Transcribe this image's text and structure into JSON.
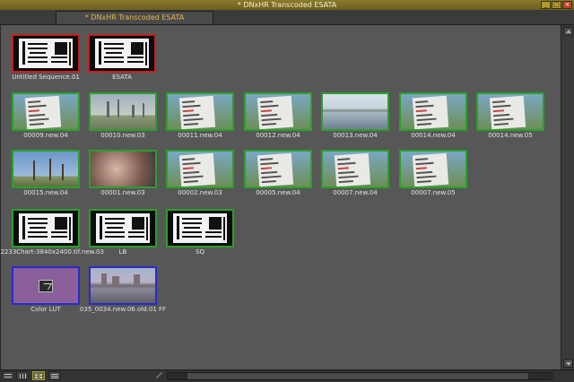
{
  "window": {
    "title": "* DNxHR Transcoded ESATA"
  },
  "tabs": [
    {
      "label": "* DNxHR Transcoded ESATA",
      "active": true
    }
  ],
  "colors": {
    "selected_border": "#c81e1e",
    "clip_border": "#2aa02a",
    "effect_border": "#2a2acc",
    "tab_text": "#e8b84a"
  },
  "clips": [
    {
      "label": "Untitled Sequence.01",
      "thumb": "chart",
      "border": "red"
    },
    {
      "label": "ESATA",
      "thumb": "chart",
      "border": "red"
    },
    {
      "label": "00009.new.04",
      "thumb": "board",
      "border": "green"
    },
    {
      "label": "00010.new.03",
      "thumb": "city",
      "border": "green"
    },
    {
      "label": "00011.new.04",
      "thumb": "board",
      "border": "green"
    },
    {
      "label": "00012.new.04",
      "thumb": "board",
      "border": "green"
    },
    {
      "label": "00013.new.04",
      "thumb": "water",
      "border": "green"
    },
    {
      "label": "00014.new.04",
      "thumb": "board",
      "border": "green"
    },
    {
      "label": "00014.new.05",
      "thumb": "board",
      "border": "green"
    },
    {
      "label": "00015.new.04",
      "thumb": "tree",
      "border": "green"
    },
    {
      "label": "00001.new.03",
      "thumb": "blur",
      "border": "green"
    },
    {
      "label": "00002.new.03",
      "thumb": "board",
      "border": "green"
    },
    {
      "label": "00005.new.04",
      "thumb": "board",
      "border": "green"
    },
    {
      "label": "00007.new.04",
      "thumb": "board",
      "border": "green"
    },
    {
      "label": "00007.new.05",
      "thumb": "board",
      "border": "green"
    },
    {
      "label": "12233Chart-3840x2400.tif.new.03",
      "thumb": "chart",
      "border": "green"
    },
    {
      "label": "LB",
      "thumb": "chart",
      "border": "green"
    },
    {
      "label": "SQ",
      "thumb": "chart",
      "border": "green"
    },
    {
      "label": "Color LUT",
      "thumb": "lut",
      "border": "blue"
    },
    {
      "label": "035_0034.new.06.old.01 FF",
      "thumb": "pond",
      "border": "blue"
    }
  ],
  "statusbar": {
    "view_buttons": [
      "brief-view-icon",
      "text-view-icon",
      "frame-view-icon",
      "script-view-icon"
    ],
    "active_view": "frame-view-icon"
  }
}
